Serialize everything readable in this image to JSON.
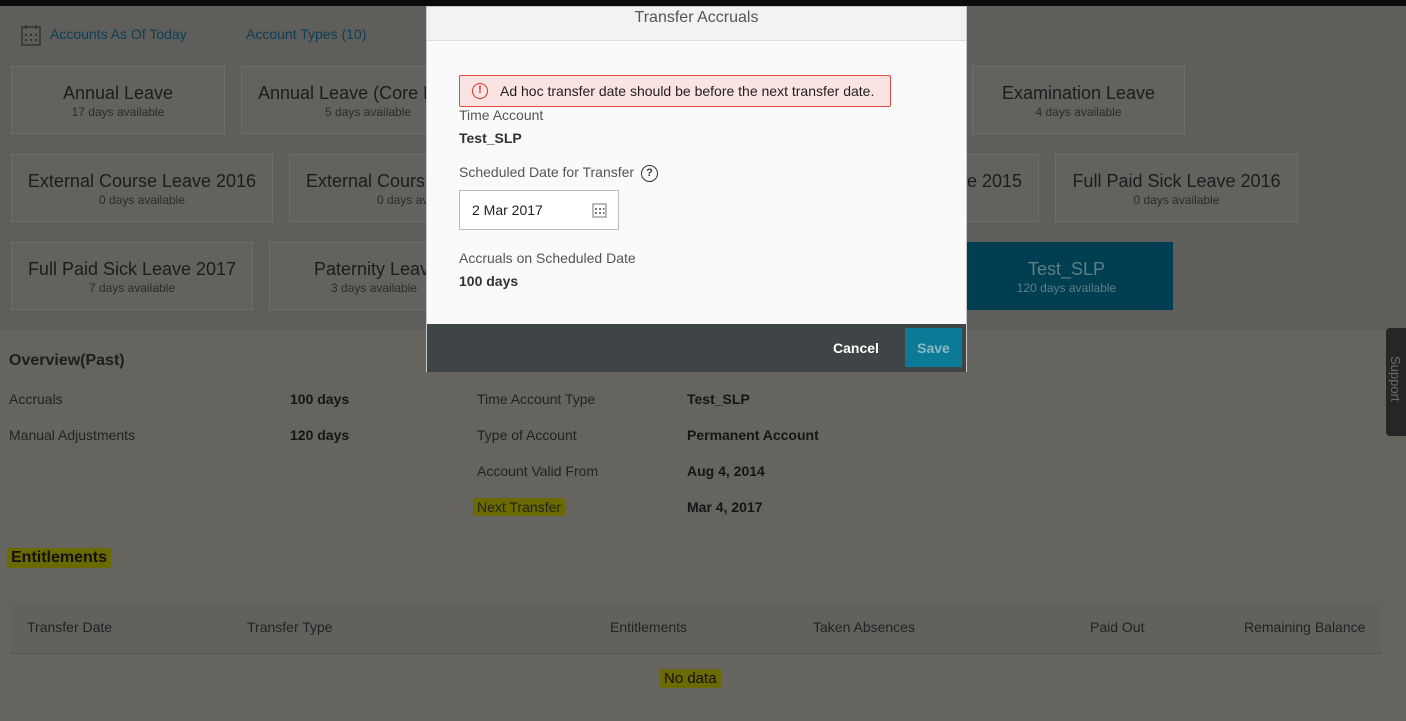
{
  "header": {
    "accounts_link": "Accounts As Of Today",
    "types_link": "Account Types (10)",
    "calendar_icon": "calendar-icon"
  },
  "cards": [
    {
      "title": "Annual Leave",
      "sub": "17 days available"
    },
    {
      "title": "Annual Leave (Core L",
      "sub": "5 days available"
    },
    {
      "title": "Examination Leave",
      "sub": "4 days available"
    },
    {
      "title": "External Course Leave 2016",
      "sub": "0 days available"
    },
    {
      "title": "External Cours",
      "sub": "0 days av"
    },
    {
      "title": "e 2015",
      "sub": ""
    },
    {
      "title": "Full Paid Sick Leave 2016",
      "sub": "0 days available"
    },
    {
      "title": "Full Paid Sick Leave 2017",
      "sub": "7 days available"
    },
    {
      "title": "Paternity Leav",
      "sub": "3 days available"
    },
    {
      "title": "Test_SLP",
      "sub": "120 days available",
      "selected": true
    }
  ],
  "overview": {
    "title": "Overview(Past)",
    "left": [
      {
        "label": "Accruals",
        "value": "100 days"
      },
      {
        "label": "Manual Adjustments",
        "value": "120 days"
      }
    ],
    "right": [
      {
        "label": "Time Account Type",
        "value": "Test_SLP"
      },
      {
        "label": "Type of Account",
        "value": "Permanent Account"
      },
      {
        "label": "Account Valid From",
        "value": "Aug 4, 2014"
      },
      {
        "label": "Next Transfer",
        "value": "Mar 4, 2017"
      }
    ]
  },
  "entitlements": {
    "title": "Entitlements",
    "columns": [
      "Transfer Date",
      "Transfer Type",
      "Entitlements",
      "Taken Absences",
      "Paid Out",
      "Remaining Balance"
    ],
    "empty": "No data"
  },
  "support": "Support",
  "dialog": {
    "title": "Transfer Accruals",
    "error": "Ad hoc transfer date should be before the next transfer date.",
    "time_account_label": "Time Account",
    "time_account_value": "Test_SLP",
    "date_label": "Scheduled Date for Transfer",
    "date_value": "2 Mar 2017",
    "accruals_label": "Accruals on Scheduled Date",
    "accruals_value": "100 days",
    "cancel": "Cancel",
    "save": "Save"
  },
  "colors": {
    "accent": "#0a7a96",
    "error": "#e34c3f",
    "highlight": "#b5b200"
  }
}
